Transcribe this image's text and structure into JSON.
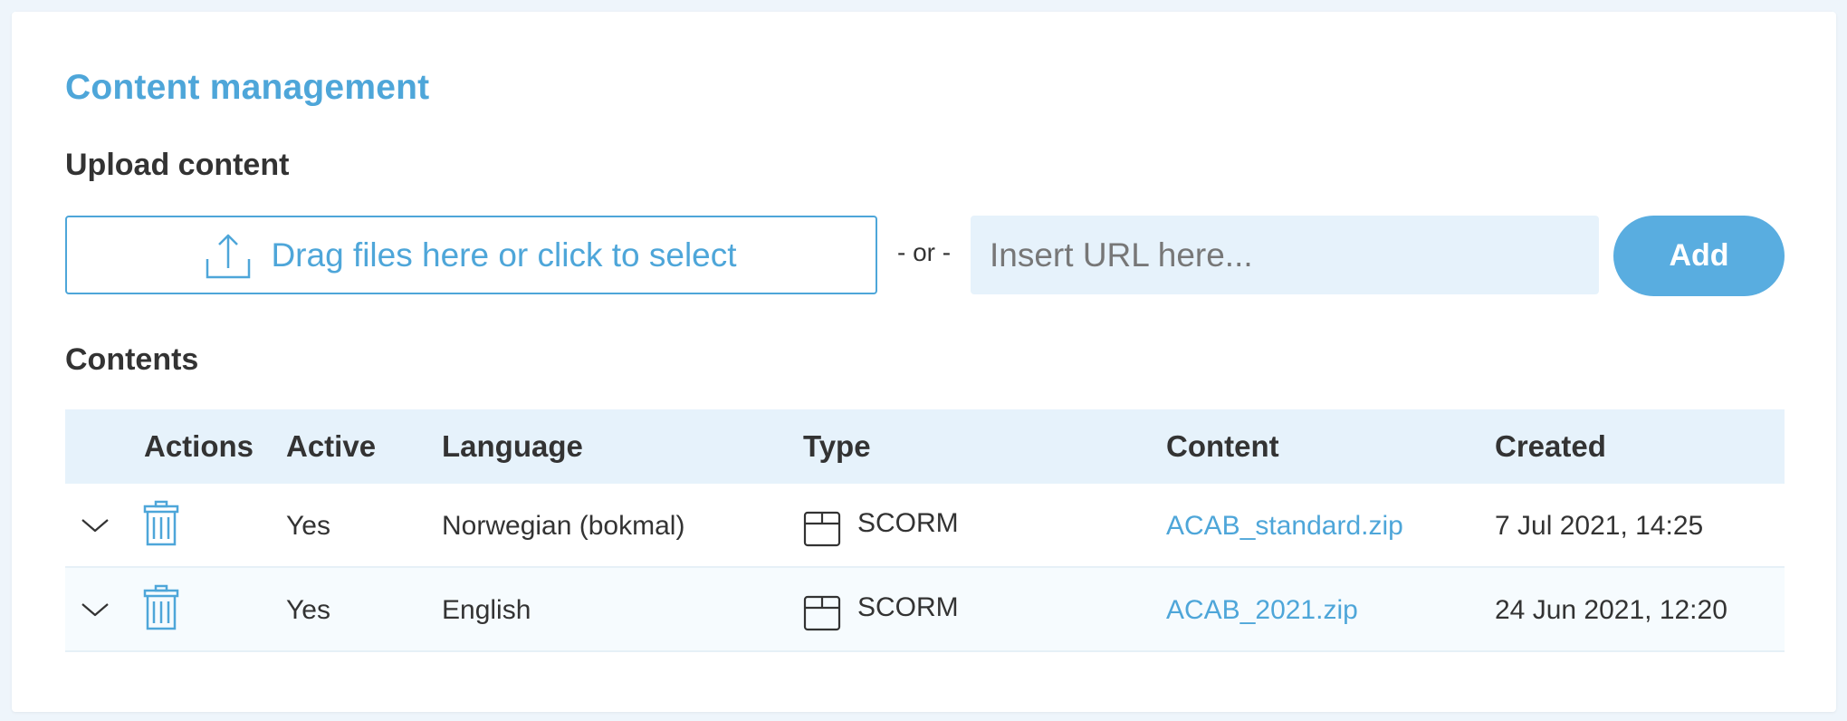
{
  "header": {
    "title": "Content management"
  },
  "upload": {
    "heading": "Upload content",
    "dropzone_label": "Drag files here or click to select",
    "or_label": "- or -",
    "url_placeholder": "Insert URL here...",
    "add_label": "Add"
  },
  "contents": {
    "heading": "Contents",
    "columns": {
      "actions": "Actions",
      "active": "Active",
      "language": "Language",
      "type": "Type",
      "content": "Content",
      "created": "Created"
    },
    "rows": [
      {
        "active": "Yes",
        "language": "Norwegian (bokmal)",
        "type": "SCORM",
        "content": "ACAB_standard.zip",
        "created": "7 Jul 2021, 14:25"
      },
      {
        "active": "Yes",
        "language": "English",
        "type": "SCORM",
        "content": "ACAB_2021.zip",
        "created": "24 Jun 2021, 12:20"
      }
    ]
  },
  "colors": {
    "accent": "#4ea6d9",
    "button": "#59ade0",
    "input_bg": "#e6f2fb",
    "text": "#333333"
  },
  "icons": {
    "upload": "upload-icon",
    "expand": "chevron-down-icon",
    "delete": "trash-icon",
    "type": "package-icon"
  }
}
